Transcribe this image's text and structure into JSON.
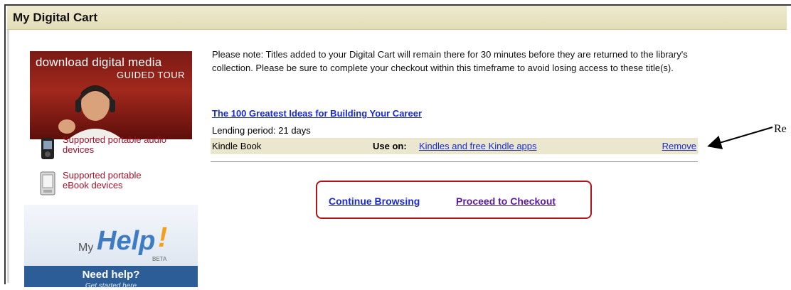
{
  "window": {
    "title": "My Digital Cart"
  },
  "sidebar": {
    "promo": {
      "title": "download digital media",
      "subtitle": "GUIDED TOUR"
    },
    "links": [
      {
        "label": "Supported portable audio devices",
        "icon": "audio-player-icon"
      },
      {
        "label": "Supported portable eBook devices",
        "icon": "ebook-reader-icon"
      }
    ],
    "help": {
      "my": "My",
      "help": "Help",
      "bang": "!",
      "beta": "BETA",
      "need": "Need help?",
      "sub": "Get started here"
    }
  },
  "main": {
    "note": "Please note: Titles added to your Digital Cart will remain there for 30 minutes before they are returned to the library's collection. Please be sure to complete your checkout within this timeframe to avoid losing access to these title(s).",
    "item": {
      "title": "The 100 Greatest Ideas for Building Your Career",
      "lending": "Lending period: 21 days",
      "format": "Kindle Book",
      "use_on_label": "Use on:",
      "use_on_link": "Kindles and free Kindle apps",
      "remove": "Remove"
    },
    "actions": {
      "continue": "Continue Browsing",
      "checkout": "Proceed to Checkout"
    }
  },
  "annotation": {
    "text": "Re",
    "color": "#000000"
  },
  "colors": {
    "link": "#1a2bd6",
    "visited": "#5a1aa0",
    "highlight": "#b0141b",
    "row_bg": "#ebe7ce"
  }
}
